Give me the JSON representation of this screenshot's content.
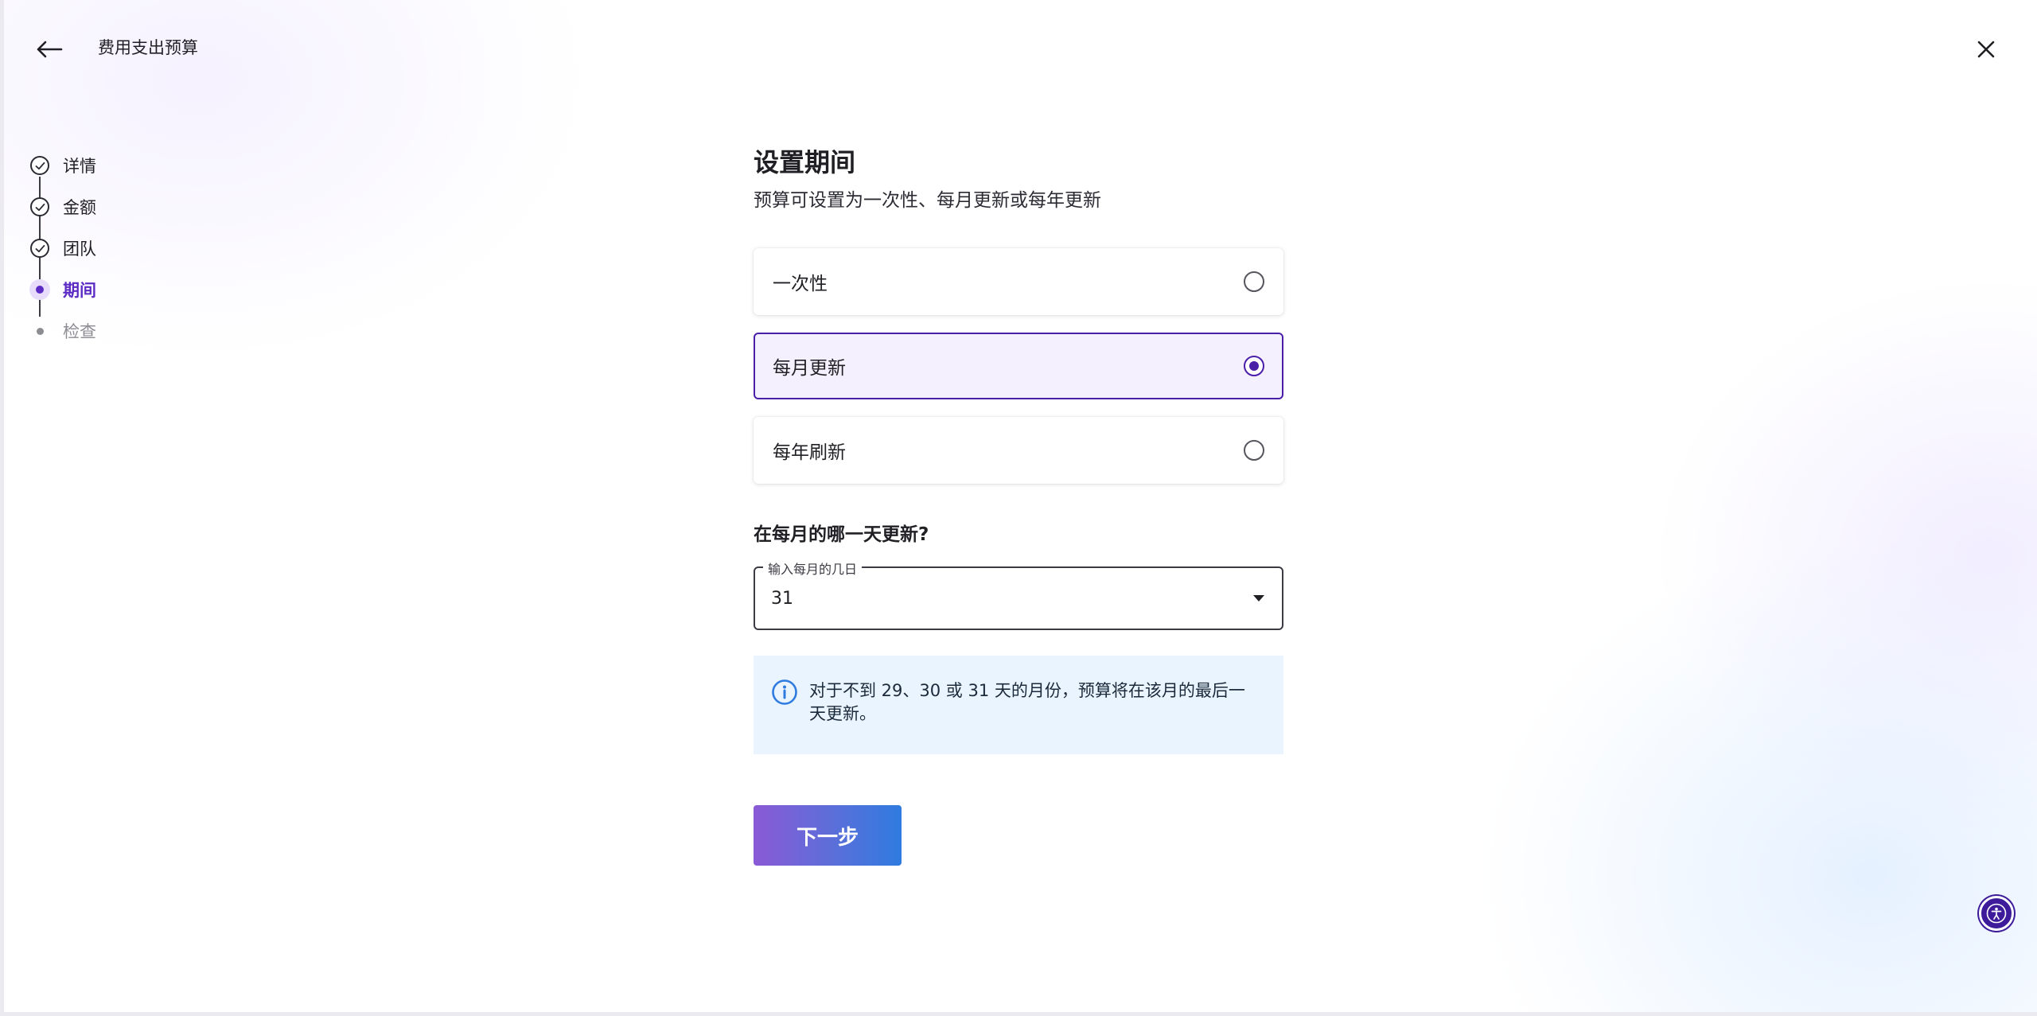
{
  "header": {
    "title": "费用支出预算"
  },
  "stepper": {
    "steps": [
      {
        "label": "详情",
        "status": "done"
      },
      {
        "label": "金额",
        "status": "done"
      },
      {
        "label": "团队",
        "status": "done"
      },
      {
        "label": "期间",
        "status": "active"
      },
      {
        "label": "检查",
        "status": "pending"
      }
    ]
  },
  "main": {
    "title": "设置期间",
    "subtitle": "预算可设置为一次性、每月更新或每年更新",
    "options": [
      {
        "label": "一次性",
        "selected": false
      },
      {
        "label": "每月更新",
        "selected": true
      },
      {
        "label": "每年刷新",
        "selected": false
      }
    ],
    "question": "在每月的哪一天更新?",
    "day_select": {
      "legend": "输入每月的几日",
      "value": "31"
    },
    "info": "对于不到 29、30 或 31 天的月份，预算将在该月的最后一天更新。",
    "next_label": "下一步"
  },
  "colors": {
    "accent": "#4a1fa8",
    "active_step": "#5b2bc4",
    "info_bg": "#eaf4fe",
    "info_icon": "#2f7be0",
    "button_gradient_start": "#8b5ad6",
    "button_gradient_end": "#2f7be0"
  },
  "icons": {
    "back": "arrow-left-icon",
    "close": "close-icon",
    "check": "check-circle-icon",
    "info": "info-icon",
    "dropdown": "caret-down-icon",
    "accessibility": "accessibility-icon"
  }
}
